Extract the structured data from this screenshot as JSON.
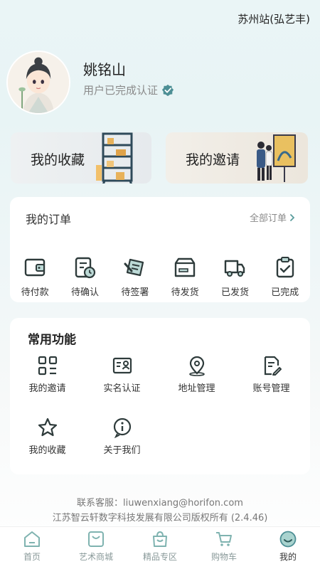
{
  "header": {
    "station": "苏州站(弘艺丰)"
  },
  "profile": {
    "name": "姚铭山",
    "verify_text": "用户已完成认证"
  },
  "promos": [
    {
      "label": "我的收藏",
      "icon": "bookshelf-illustration"
    },
    {
      "label": "我的邀请",
      "icon": "art-gallery-illustration"
    }
  ],
  "orders": {
    "title": "我的订单",
    "all_label": "全部订单",
    "items": [
      {
        "label": "待付款",
        "icon": "wallet-icon"
      },
      {
        "label": "待确认",
        "icon": "pending-confirm-icon"
      },
      {
        "label": "待签署",
        "icon": "sign-icon"
      },
      {
        "label": "待发货",
        "icon": "box-icon"
      },
      {
        "label": "已发货",
        "icon": "truck-icon"
      },
      {
        "label": "已完成",
        "icon": "clipboard-check-icon"
      }
    ]
  },
  "functions": {
    "title": "常用功能",
    "items": [
      {
        "label": "我的邀请",
        "icon": "grid-icon"
      },
      {
        "label": "实名认证",
        "icon": "id-card-icon"
      },
      {
        "label": "地址管理",
        "icon": "location-icon"
      },
      {
        "label": "账号管理",
        "icon": "edit-doc-icon"
      },
      {
        "label": "我的收藏",
        "icon": "star-icon"
      },
      {
        "label": "关于我们",
        "icon": "info-icon"
      }
    ]
  },
  "footer": {
    "contact": "联系客服：liuwenxiang@horifon.com",
    "copyright": "江苏智云轩数字科技发展有限公司版权所有 (2.4.46)"
  },
  "tabs": [
    {
      "label": "首页",
      "icon": "home-icon"
    },
    {
      "label": "艺术商城",
      "icon": "shopping-bag-icon"
    },
    {
      "label": "精品专区",
      "icon": "premium-bag-icon"
    },
    {
      "label": "购物车",
      "icon": "cart-icon"
    },
    {
      "label": "我的",
      "icon": "profile-smile-icon"
    }
  ],
  "colors": {
    "accent": "#5a9c9c",
    "icon_stroke": "#2e3b3b",
    "verify": "#4d8f95"
  }
}
